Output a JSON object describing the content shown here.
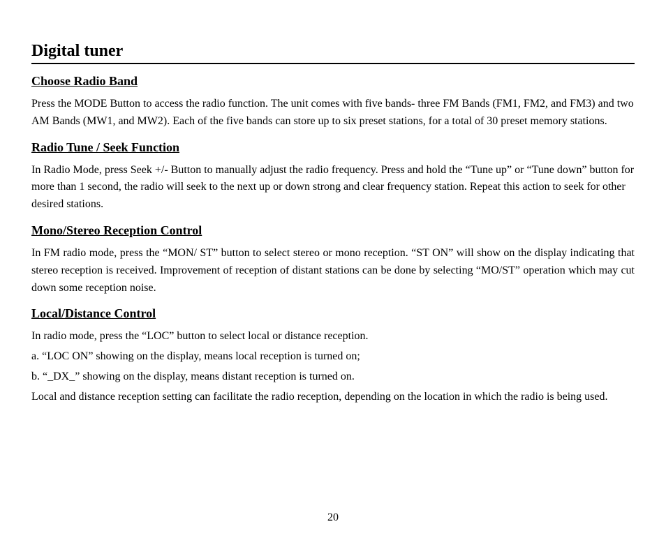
{
  "title": "Digital tuner",
  "sections": [
    {
      "heading": "Choose Radio Band",
      "paragraphs": [
        "Press the MODE Button to access the radio function. The unit comes with five bands- three FM Bands (FM1, FM2, and FM3) and two AM Bands (MW1, and MW2). Each of the five bands can store up to six preset stations, for a total of 30 preset memory stations."
      ],
      "justify": false
    },
    {
      "heading": "Radio Tune / Seek Function",
      "paragraphs": [
        "In Radio Mode, press Seek +/- Button to manually adjust the radio frequency. Press and hold the “Tune up” or “Tune down” button for more than 1 second, the radio will seek to the next up or down strong and clear frequency station. Repeat this action to seek for other desired stations."
      ],
      "justify": false
    },
    {
      "heading": "Mono/Stereo Reception Control",
      "paragraphs": [
        "In FM radio mode, press the “MON/ ST” button to select stereo or mono reception. “ST ON” will show on the display indicating that stereo reception is received. Improvement of reception of distant stations can be done by selecting “MO/ST” operation which may cut down some reception noise."
      ],
      "justify": true
    },
    {
      "heading": "Local/Distance Control",
      "paragraphs": [
        "In radio mode, press the “LOC” button to select local or distance reception.",
        "a. “LOC ON” showing on the display, means local reception is turned on;",
        "b. “_DX_” showing on the display, means distant reception is turned on.",
        "Local and distance reception setting can facilitate the radio reception, depending on the location in which the radio is being used."
      ],
      "justify": false
    }
  ],
  "pageNumber": "20"
}
